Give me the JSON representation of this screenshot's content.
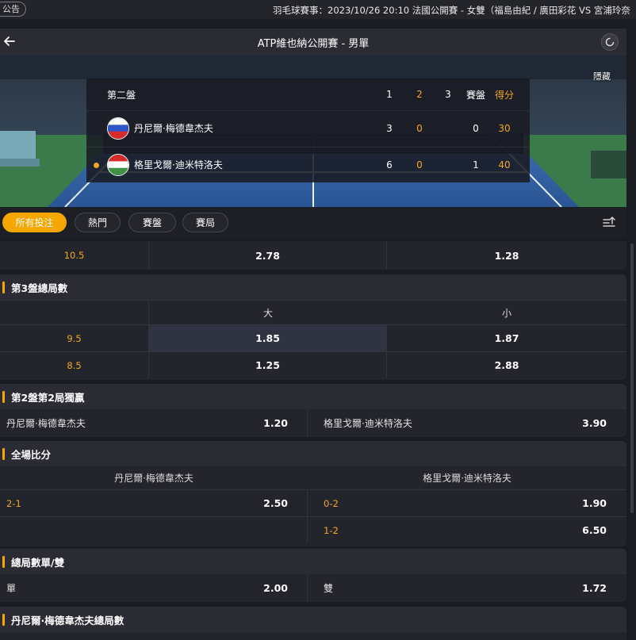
{
  "ticker": {
    "badge": "公告",
    "message": "羽毛球賽事：2023/10/26 20:10 法國公開賽 - 女雙（福島由紀 / 廣田彩花 VS 宮浦玲奈"
  },
  "header": {
    "title": "ATP維也納公開賽 - 男單"
  },
  "scoreboard": {
    "hide_label": "隱藏",
    "set_label": "第二盤",
    "columns": [
      "1",
      "2",
      "3",
      "賽盤",
      "得分"
    ],
    "players": [
      {
        "name": "丹尼爾·梅德韋杰夫",
        "set1": "3",
        "set2": "0",
        "sets": "0",
        "points": "30",
        "flag": "russia",
        "serving": false
      },
      {
        "name": "格里戈爾·迪米特洛夫",
        "set1": "6",
        "set2": "0",
        "sets": "1",
        "points": "40",
        "flag": "hungary",
        "serving": true
      }
    ]
  },
  "tabs": [
    "所有投注",
    "熱門",
    "賽盤",
    "賽局"
  ],
  "partial_row": {
    "line": "10.5",
    "over": "2.78",
    "under": "1.28"
  },
  "set3_total": {
    "title": "第3盤總局數",
    "over_label": "大",
    "under_label": "小",
    "rows": [
      {
        "line": "9.5",
        "over": "1.85",
        "under": "1.87"
      },
      {
        "line": "8.5",
        "over": "1.25",
        "under": "2.88"
      }
    ]
  },
  "set2_game2": {
    "title": "第2盤第2局獨贏",
    "home": {
      "name": "丹尼爾·梅德韋杰夫",
      "odds": "1.20"
    },
    "away": {
      "name": "格里戈爾·迪米特洛夫",
      "odds": "3.90"
    }
  },
  "correct_score": {
    "title": "全場比分",
    "home_name": "丹尼爾·梅德韋杰夫",
    "away_name": "格里戈爾·迪米特洛夫",
    "home": [
      {
        "score": "2-1",
        "odds": "2.50"
      }
    ],
    "away": [
      {
        "score": "0-2",
        "odds": "1.90"
      },
      {
        "score": "1-2",
        "odds": "6.50"
      }
    ]
  },
  "odd_even": {
    "title": "總局數單/雙",
    "odd": {
      "label": "單",
      "odds": "2.00"
    },
    "even": {
      "label": "雙",
      "odds": "1.72"
    }
  },
  "player_total": {
    "title": "丹尼爾·梅德韋杰夫總局數"
  },
  "colors": {
    "accent": "#f5a700",
    "background": "#1b1c22",
    "panel": "#24252c"
  }
}
